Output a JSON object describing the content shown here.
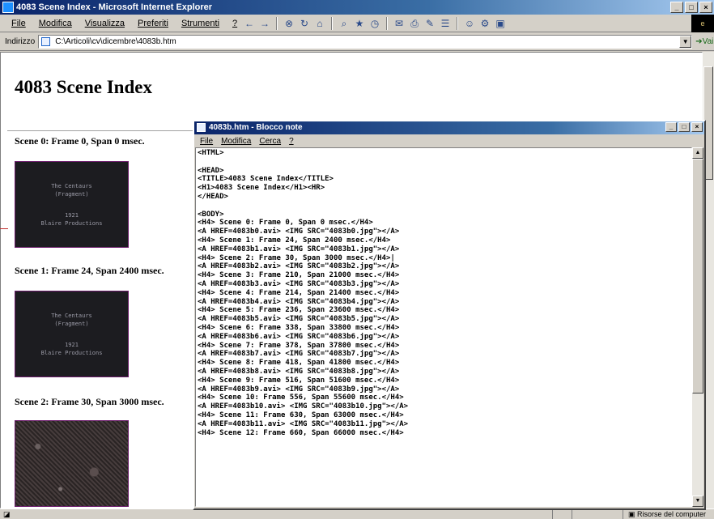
{
  "ie": {
    "title": "4083 Scene Index - Microsoft Internet Explorer",
    "menu": [
      "File",
      "Modifica",
      "Visualizza",
      "Preferiti",
      "Strumenti",
      "?"
    ],
    "address_label": "Indirizzo",
    "address_value": "C:\\Articoli\\cv\\dicembre\\4083b.htm",
    "go_label": "Vai",
    "status_zone": "Risorse del computer"
  },
  "page": {
    "heading": "4083 Scene Index",
    "scenes": [
      {
        "label": "Scene 0: Frame 0, Span 0 msec.",
        "thumb_lines": [
          "The Centaurs",
          "(Fragment)",
          "",
          "1921",
          "Blaire Productions"
        ]
      },
      {
        "label": "Scene 1: Frame 24, Span 2400 msec.",
        "thumb_lines": [
          "The Centaurs",
          "(Fragment)",
          "",
          "1921",
          "Blaire Productions"
        ]
      },
      {
        "label": "Scene 2: Frame 30, Span 3000 msec.",
        "thumb_lines": []
      }
    ]
  },
  "notepad": {
    "title": "4083b.htm - Blocco note",
    "menu": [
      "File",
      "Modifica",
      "Cerca",
      "?"
    ],
    "lines": [
      "<HTML>",
      "",
      "<HEAD>",
      "<TITLE>4083 Scene Index</TITLE>",
      "<H1>4083 Scene Index</H1><HR>",
      "</HEAD>",
      "",
      "<BODY>",
      "<H4> Scene 0: Frame 0, Span 0 msec.</H4>",
      "<A HREF=4083b0.avi> <IMG SRC=\"4083b0.jpg\"></A>",
      "<H4> Scene 1: Frame 24, Span 2400 msec.</H4>",
      "<A HREF=4083b1.avi> <IMG SRC=\"4083b1.jpg\"></A>",
      "<H4> Scene 2: Frame 30, Span 3000 msec.</H4>|",
      "<A HREF=4083b2.avi> <IMG SRC=\"4083b2.jpg\"></A>",
      "<H4> Scene 3: Frame 210, Span 21000 msec.</H4>",
      "<A HREF=4083b3.avi> <IMG SRC=\"4083b3.jpg\"></A>",
      "<H4> Scene 4: Frame 214, Span 21400 msec.</H4>",
      "<A HREF=4083b4.avi> <IMG SRC=\"4083b4.jpg\"></A>",
      "<H4> Scene 5: Frame 236, Span 23600 msec.</H4>",
      "<A HREF=4083b5.avi> <IMG SRC=\"4083b5.jpg\"></A>",
      "<H4> Scene 6: Frame 338, Span 33800 msec.</H4>",
      "<A HREF=4083b6.avi> <IMG SRC=\"4083b6.jpg\"></A>",
      "<H4> Scene 7: Frame 378, Span 37800 msec.</H4>",
      "<A HREF=4083b7.avi> <IMG SRC=\"4083b7.jpg\"></A>",
      "<H4> Scene 8: Frame 418, Span 41800 msec.</H4>",
      "<A HREF=4083b8.avi> <IMG SRC=\"4083b8.jpg\"></A>",
      "<H4> Scene 9: Frame 516, Span 51600 msec.</H4>",
      "<A HREF=4083b9.avi> <IMG SRC=\"4083b9.jpg\"></A>",
      "<H4> Scene 10: Frame 556, Span 55600 msec.</H4>",
      "<A HREF=4083b10.avi> <IMG SRC=\"4083b10.jpg\"></A>",
      "<H4> Scene 11: Frame 630, Span 63000 msec.</H4>",
      "<A HREF=4083b11.avi> <IMG SRC=\"4083b11.jpg\"></A>",
      "<H4> Scene 12: Frame 660, Span 66000 msec.</H4>"
    ]
  }
}
